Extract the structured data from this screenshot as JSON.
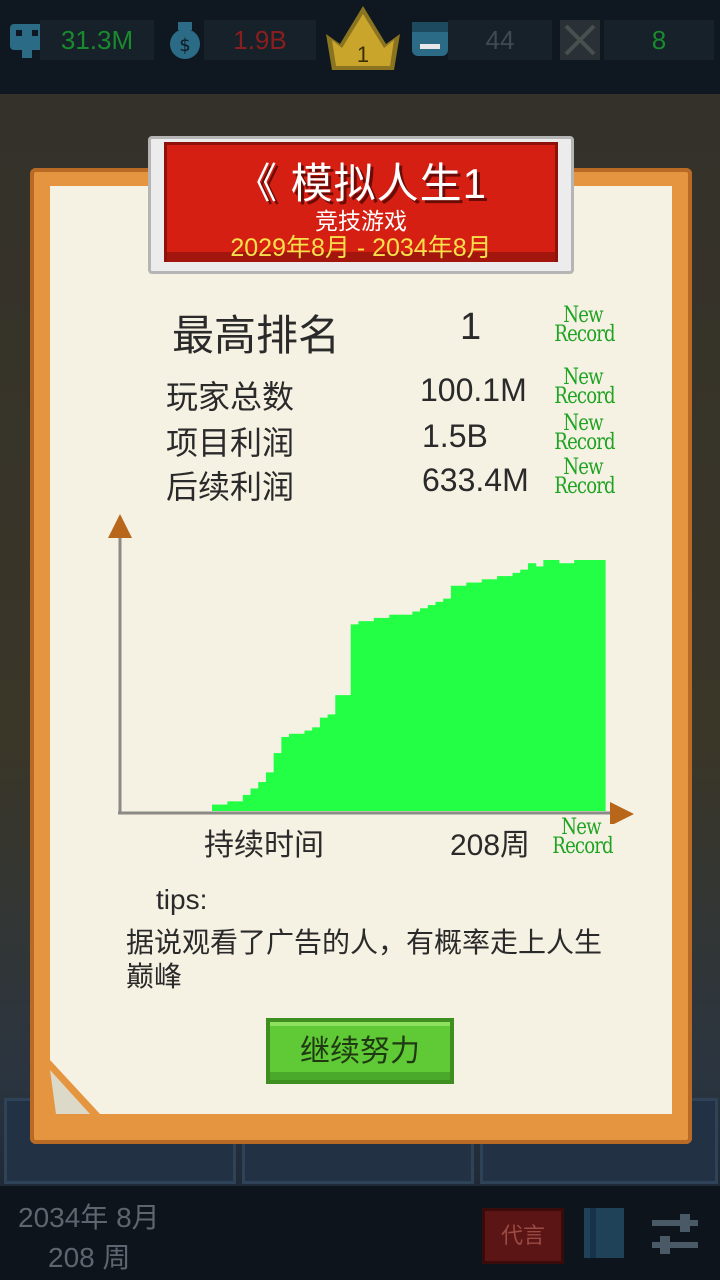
{
  "top_bar": {
    "fans": "31.3M",
    "money": "1.9B",
    "rank": "1",
    "employees": "44",
    "fails": "8",
    "colors": {
      "fans": "#1a8a2e",
      "money": "#8a1e1e",
      "gray": "#3f4a52",
      "gold": "#c9a52b"
    }
  },
  "dialog": {
    "title": "《 模拟人生1",
    "genre": "竞技游戏",
    "period": "2029年8月 - 2034年8月",
    "best_rank_label": "最高排名",
    "best_rank_value": "1",
    "stats": [
      {
        "label": "玩家总数",
        "value": "100.1M"
      },
      {
        "label": "项目利润",
        "value": "1.5B"
      },
      {
        "label": "后续利润",
        "value": "633.4M"
      }
    ],
    "new_record_line1": "New",
    "new_record_line2": "Record",
    "duration_label": "持续时间",
    "duration_value": "208周",
    "tips_label": "tips:",
    "tips_text": "据说观看了广告的人，有概率走上人生巅峰",
    "continue_button": "继续努力"
  },
  "chart_data": {
    "type": "area",
    "title": "",
    "xlabel": "持续时间",
    "ylabel": "",
    "x_end_label": "208周",
    "color": "#22ff44",
    "grid": false,
    "legend": "none",
    "series": [
      {
        "values": [
          2,
          2,
          3,
          3,
          5,
          7,
          9,
          12,
          18,
          23,
          24,
          24,
          25,
          26,
          29,
          30,
          36,
          36,
          58,
          59,
          59,
          60,
          60,
          61,
          61,
          61,
          62,
          63,
          64,
          65,
          66,
          70,
          70,
          71,
          71,
          72,
          72,
          73,
          73,
          74,
          75,
          77,
          76,
          78,
          78,
          77,
          77,
          78,
          78,
          78,
          78
        ]
      }
    ]
  },
  "bottom_bar": {
    "date": "2034年 8月",
    "week": "208 周",
    "red_button": "代言"
  }
}
